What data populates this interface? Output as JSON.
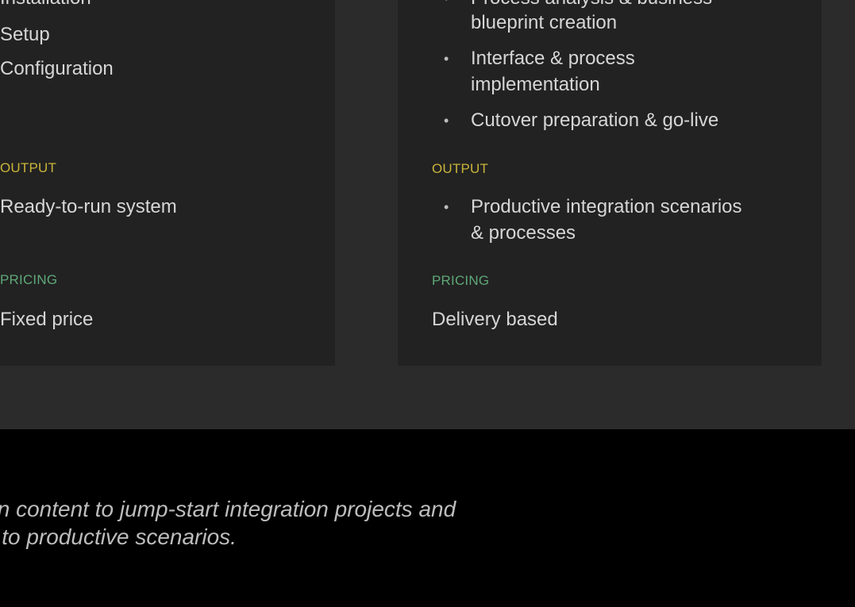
{
  "left_card": {
    "items": [
      "Installation",
      "Setup",
      "Configuration"
    ],
    "output_label": "OUTPUT",
    "output_text": "Ready-to-run system",
    "pricing_label": "PRICING",
    "pricing_text": "Fixed price"
  },
  "right_card": {
    "items": [
      {
        "line1": "Process analysis & business",
        "line2": "blueprint creation"
      },
      {
        "line1": "Interface & process",
        "line2": "implementation"
      },
      {
        "line1": "Cutover preparation & go-live"
      }
    ],
    "output_label": "OUTPUT",
    "output_items": [
      {
        "line1": "Productive integration scenarios",
        "line2": "& processes"
      }
    ],
    "pricing_label": "PRICING",
    "pricing_text": "Delivery based"
  },
  "tagline": {
    "line1": "Integration content to jump-start integration projects and",
    "line2": "move to productive scenarios."
  },
  "colors": {
    "section_bg": "#2b2b2b",
    "card_bg": "#222222",
    "footer_bg": "#000000",
    "output_label": "#c9b43b",
    "pricing_label": "#5fa878",
    "text": "#d6d6d6"
  }
}
